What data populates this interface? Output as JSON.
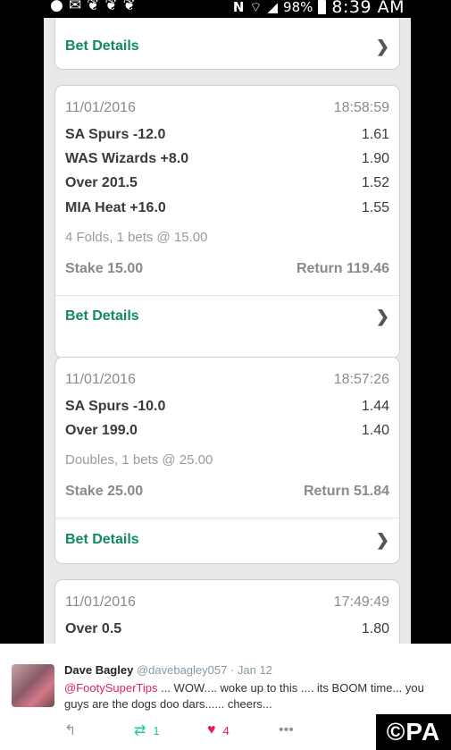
{
  "status_bar": {
    "left_icons": [
      "chat-icon",
      "mail-icon",
      "twitter-icon",
      "twitter-icon",
      "twitter-icon"
    ],
    "nfc": "N",
    "battery": "98%",
    "time": "8:39 AM"
  },
  "cards": [
    {
      "details_label": "Bet Details"
    },
    {
      "date": "11/01/2016",
      "time": "18:58:59",
      "selections": [
        {
          "name": "SA Spurs -12.0",
          "odds": "1.61"
        },
        {
          "name": "WAS Wizards +8.0",
          "odds": "1.90"
        },
        {
          "name": "Over 201.5",
          "odds": "1.52"
        },
        {
          "name": "MIA Heat +16.0",
          "odds": "1.55"
        }
      ],
      "info": "4 Folds, 1 bets @ 15.00",
      "stake": "Stake 15.00",
      "return": "Return 119.46",
      "details_label": "Bet Details"
    },
    {
      "date": "11/01/2016",
      "time": "18:57:26",
      "selections": [
        {
          "name": "SA Spurs -10.0",
          "odds": "1.44"
        },
        {
          "name": "Over 199.0",
          "odds": "1.40"
        }
      ],
      "info": "Doubles, 1 bets @ 25.00",
      "stake": "Stake 25.00",
      "return": "Return 51.84",
      "details_label": "Bet Details"
    },
    {
      "date": "11/01/2016",
      "time": "17:49:49",
      "selections": [
        {
          "name": "Over 0.5",
          "odds": "1.80"
        }
      ]
    }
  ],
  "tweet": {
    "name": "Dave Bagley",
    "handle": "@davebagley057",
    "sep_date": " · Jan 12",
    "mention": "@FootySuperTips",
    "text": " ... WOW.... woke up to this .... its BOOM time... you guys are the dogs doo dars...... cheers...",
    "retweets": "1",
    "likes": "4"
  },
  "watermark": "©PA",
  "colors": {
    "accent_green": "#108a5f",
    "background": "#e9e9e9",
    "like_red": "#e81c4f",
    "retweet_green": "#19cf86"
  }
}
